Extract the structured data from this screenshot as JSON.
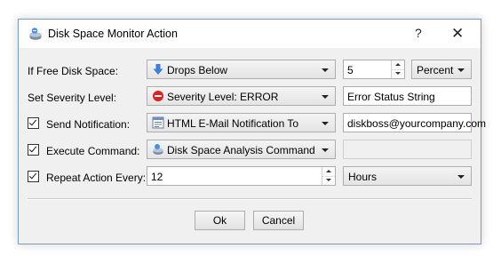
{
  "window": {
    "title": "Disk Space Monitor Action",
    "help": "?",
    "close": "✕"
  },
  "rows": {
    "free_space": {
      "label": "If Free Disk Space:",
      "condition": "Drops Below",
      "value": "5",
      "unit": "Percent"
    },
    "severity": {
      "label": "Set Severity Level:",
      "level": "Severity Level: ERROR",
      "status_string": "Error Status String"
    },
    "notification": {
      "label": "Send Notification:",
      "checked": true,
      "method": "HTML E-Mail Notification To",
      "email": "diskboss@yourcompany.com"
    },
    "command": {
      "label": "Execute Command:",
      "checked": true,
      "command": "Disk Space Analysis Command",
      "argument": ""
    },
    "repeat": {
      "label": "Repeat Action Every:",
      "checked": true,
      "value": "12",
      "unit": "Hours"
    }
  },
  "buttons": {
    "ok": "Ok",
    "cancel": "Cancel"
  },
  "colors": {
    "accent_border": "#7a9cc4",
    "error_red": "#e02020",
    "arrow_blue": "#3b7fd6"
  }
}
